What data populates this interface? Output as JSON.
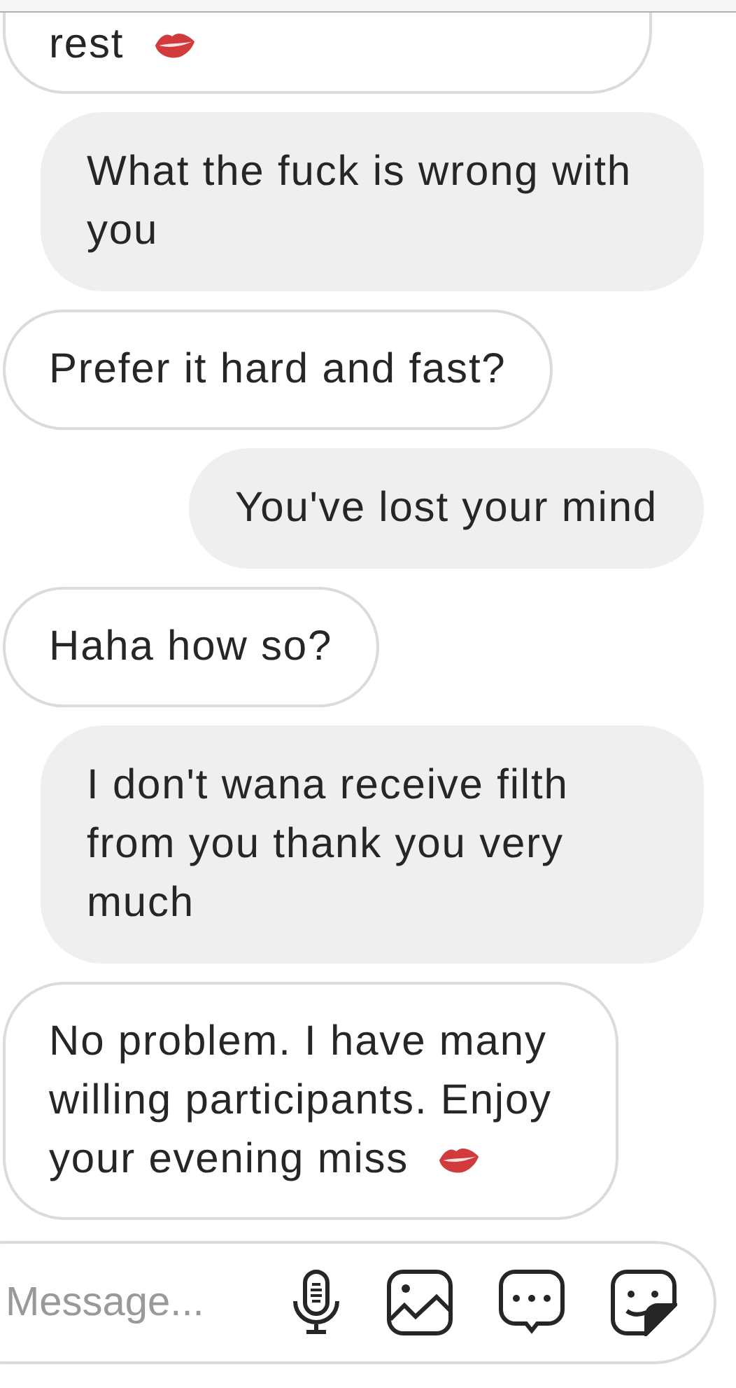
{
  "messages": [
    {
      "text": "rest",
      "outgoing": false,
      "kiss": true,
      "cut_top": true
    },
    {
      "text": "What the fuck is wrong with you",
      "outgoing": true,
      "kiss": false,
      "cut_top": false
    },
    {
      "text": "Prefer it hard and fast?",
      "outgoing": false,
      "kiss": false,
      "cut_top": false
    },
    {
      "text": "You've lost your mind",
      "outgoing": true,
      "kiss": false,
      "cut_top": false
    },
    {
      "text": "Haha how so?",
      "outgoing": false,
      "kiss": false,
      "cut_top": false
    },
    {
      "text": "I don't wana receive filth from you thank you very much",
      "outgoing": true,
      "kiss": false,
      "cut_top": false
    },
    {
      "text": "No problem. I have many willing participants. Enjoy your evening miss",
      "outgoing": false,
      "kiss": true,
      "cut_top": false
    }
  ],
  "composer": {
    "placeholder": "Message..."
  }
}
